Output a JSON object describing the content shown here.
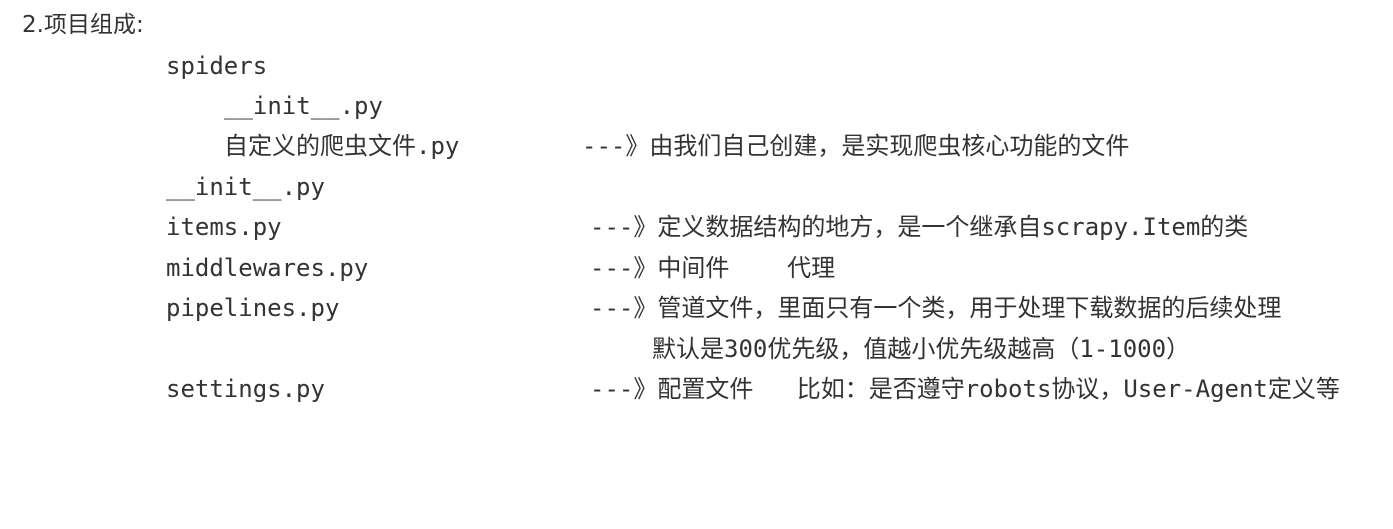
{
  "heading": "2.项目组成:",
  "tree": {
    "spiders": "spiders",
    "spiders_init": "__init__.py",
    "custom_spider": {
      "name": "自定义的爬虫文件.py",
      "desc": "---》由我们自己创建，是实现爬虫核心功能的文件"
    },
    "init": "__init__.py",
    "items": {
      "name": "items.py",
      "desc": "---》定义数据结构的地方，是一个继承自scrapy.Item的类"
    },
    "middlewares": {
      "name": "middlewares.py",
      "desc": "---》中间件    代理"
    },
    "pipelines": {
      "name": "pipelines.py",
      "desc": "---》管道文件，里面只有一个类，用于处理下载数据的后续处理",
      "desc_cont": "默认是300优先级，值越小优先级越高（1-1000）"
    },
    "settings": {
      "name": "settings.py",
      "desc": "---》配置文件   比如：是否遵守robots协议，User-Agent定义等"
    }
  }
}
